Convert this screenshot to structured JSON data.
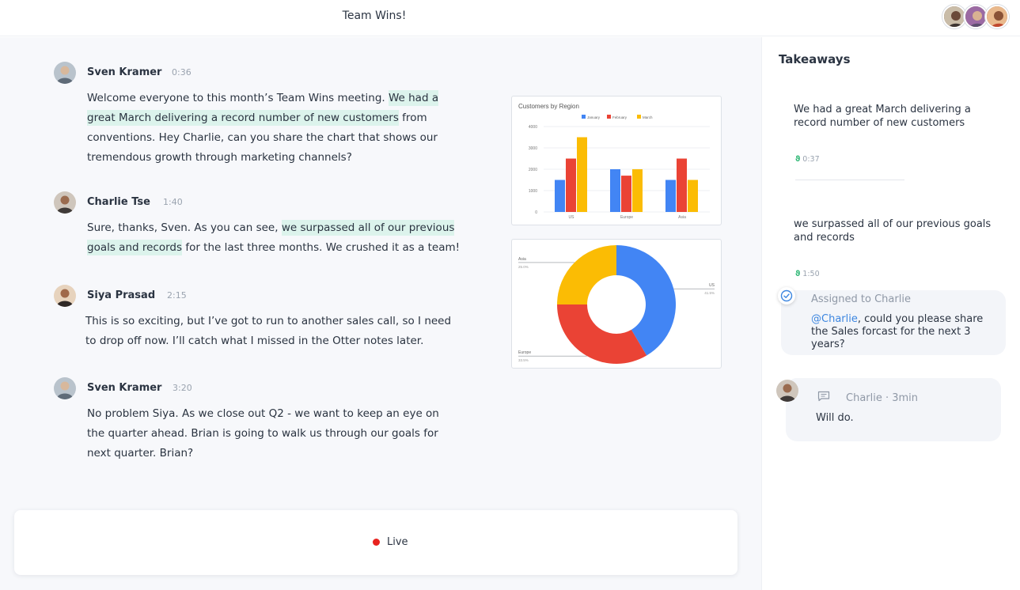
{
  "header": {
    "title": "Team Wins!"
  },
  "participants": [
    "participant-1",
    "participant-2",
    "participant-3"
  ],
  "messages": [
    {
      "speaker": "Sven Kramer",
      "time": "0:36",
      "pre": "Welcome everyone to this month’s Team Wins meeting. ",
      "hl": "We had a great March delivering a record number of new customers",
      "post": " from conventions. Hey Charlie, can you share the chart that shows our tremendous growth through marketing channels?"
    },
    {
      "speaker": "Charlie Tse",
      "time": "1:40",
      "pre": "Sure, thanks, Sven. As you can see, ",
      "hl": "we surpassed all of our previous goals and records",
      "post": " for the last three months. We crushed it as a team!"
    },
    {
      "speaker": "Siya Prasad",
      "time": "2:15",
      "text": "This is so exciting, but I’ve got to run to another sales call, so I need to drop off now. I’ll catch what I missed in the Otter notes later."
    },
    {
      "speaker": "Sven Kramer",
      "time": "3:20",
      "text": "No problem Siya. As we close out Q2 - we want to keep an eye on the quarter ahead. Brian is going to walk us through our goals for next quarter. Brian?"
    }
  ],
  "chart_data": [
    {
      "type": "bar",
      "title": "Customers by Region",
      "categories": [
        "US",
        "Europe",
        "Asia"
      ],
      "series": [
        {
          "name": "January",
          "color": "#4285f4",
          "values": [
            1500,
            2000,
            1500
          ]
        },
        {
          "name": "February",
          "color": "#ea4335",
          "values": [
            2500,
            1700,
            2500
          ]
        },
        {
          "name": "March",
          "color": "#fbbc04",
          "values": [
            3500,
            2000,
            1500
          ]
        }
      ],
      "yticks": [
        "0",
        "1000",
        "2000",
        "3000",
        "4000"
      ],
      "ylim": [
        0,
        4000
      ],
      "legend": "top"
    },
    {
      "type": "pie",
      "donut": true,
      "slices": [
        {
          "label": "US",
          "pct": "41.5%",
          "value": 41.5,
          "color": "#4285f4"
        },
        {
          "label": "Europe",
          "pct": "33.5%",
          "value": 33.5,
          "color": "#ea4335"
        },
        {
          "label": "Asia",
          "pct": "25.0%",
          "value": 25.0,
          "color": "#fbbc04"
        }
      ]
    }
  ],
  "live": {
    "label": "Live",
    "dot_color": "#e8231f"
  },
  "sidebar": {
    "title": "Takeaways",
    "takeaways": [
      {
        "text": "We had a great March delivering a record number of new customers",
        "time": "0:37"
      },
      {
        "text": "we surpassed all of our previous goals and records",
        "time": "1:50"
      }
    ],
    "assignment": {
      "label": "Assigned to Charlie",
      "mention": "@Charlie",
      "text": ", could you please share the Sales forcast for the next 3 years?"
    },
    "comment": {
      "meta": "Charlie · 3min",
      "text": "Will do."
    }
  },
  "colors": {
    "highlight": "#dcf3ec",
    "mention": "#3c86e0",
    "accent_green": "#2bb673"
  }
}
